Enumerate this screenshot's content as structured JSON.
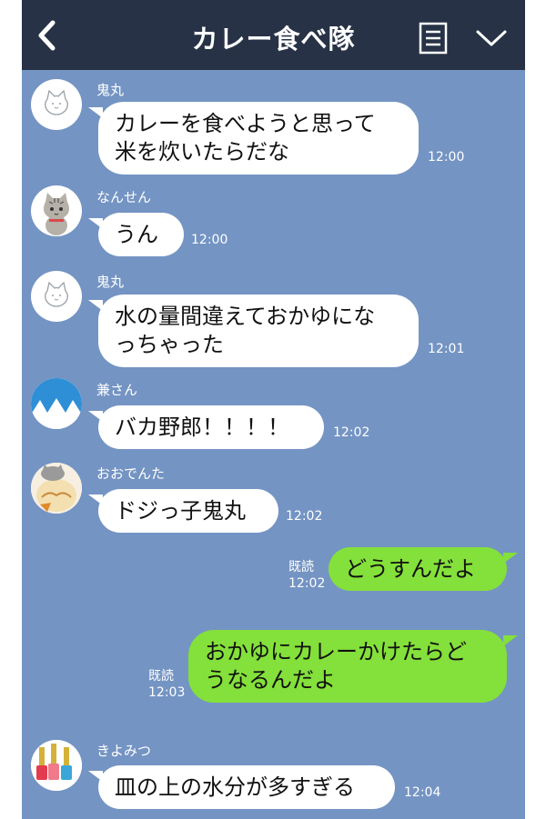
{
  "header": {
    "title": "カレー食べ隊",
    "icons": {
      "back": "chevron-left-icon",
      "menu": "note-list-icon",
      "expand": "chevron-down-icon"
    }
  },
  "messages": [
    {
      "sender": "鬼丸",
      "lines": [
        "カレーを食べようと思って",
        "米を炊いたらだな"
      ],
      "time": "12:00",
      "avatar": "cat-outline-avatar"
    },
    {
      "sender": "なんせん",
      "lines": [
        "うん"
      ],
      "time": "12:00",
      "avatar": "tabby-cat-avatar"
    },
    {
      "sender": "鬼丸",
      "lines": [
        "水の量間違えておかゆにな",
        "っちゃった"
      ],
      "time": "12:01",
      "avatar": "cat-outline-avatar"
    },
    {
      "sender": "兼さん",
      "lines": [
        "バカ野郎！！！！"
      ],
      "time": "12:02",
      "avatar": "mountain-avatar"
    },
    {
      "sender": "おおでんた",
      "lines": [
        "ドジっ子鬼丸"
      ],
      "time": "12:02",
      "avatar": "bread-cat-avatar"
    },
    {
      "sender": "",
      "lines": [
        "どうすんだよ"
      ],
      "time": "12:02",
      "read_label": "既読",
      "outgoing": true
    },
    {
      "sender": "",
      "lines": [
        "おかゆにカレーかけたらど",
        "うなるんだよ"
      ],
      "time": "12:03",
      "read_label": "既読",
      "outgoing": true
    },
    {
      "sender": "きよみつ",
      "lines": [
        "皿の上の水分が多すぎる"
      ],
      "time": "12:04",
      "avatar": "nail-polish-avatar"
    }
  ],
  "colors": {
    "header": "#273246",
    "chat_bg": "#7494c3",
    "outgoing_bubble": "#84e03a",
    "incoming_bubble": "#ffffff"
  }
}
